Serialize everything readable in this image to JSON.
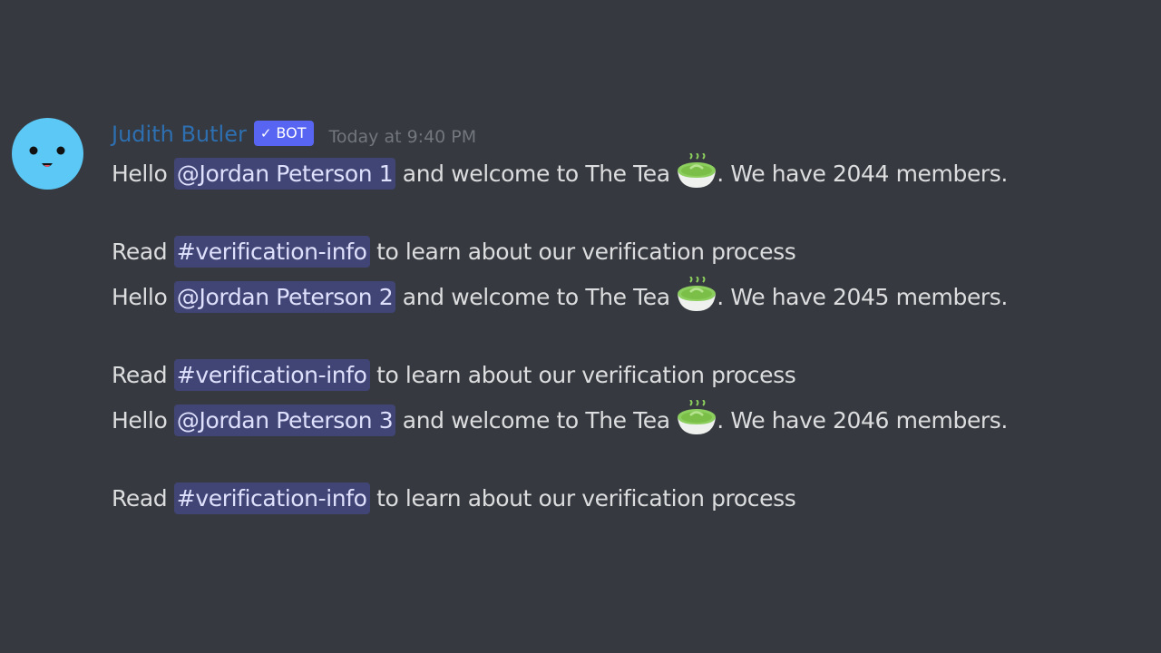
{
  "message": {
    "author": "Judith Butler",
    "bot_check": "✓",
    "bot_label": "BOT",
    "timestamp": "Today at 9:40 PM",
    "avatar_icon": "smiley-face-icon",
    "entries": [
      {
        "hello": "Hello ",
        "user_mention": "@Jordan Peterson 1",
        "welcome": " and welcome to The Tea ",
        "emoji": "matcha-tea-bowl-icon",
        "members": ". We have 2044 members.",
        "read": "Read ",
        "channel_mention": "#verification-info",
        "learn": " to learn about our verification process"
      },
      {
        "hello": "Hello ",
        "user_mention": "@Jordan Peterson 2",
        "welcome": " and welcome to The Tea ",
        "emoji": "matcha-tea-bowl-icon",
        "members": ". We have 2045 members.",
        "read": "Read ",
        "channel_mention": "#verification-info",
        "learn": " to learn about our verification process"
      },
      {
        "hello": "Hello ",
        "user_mention": "@Jordan Peterson 3",
        "welcome": " and welcome to The Tea ",
        "emoji": "matcha-tea-bowl-icon",
        "members": ". We have 2046 members.",
        "read": "Read ",
        "channel_mention": "#verification-info",
        "learn": " to learn about our verification process"
      }
    ]
  },
  "colors": {
    "background": "#36393f",
    "username": "#2d6fb0",
    "bot_tag": "#5865f2",
    "text": "#dcddde",
    "timestamp": "#72767d",
    "mention_bg": "rgba(88,101,242,0.30)",
    "avatar": "#5bc8f5"
  }
}
